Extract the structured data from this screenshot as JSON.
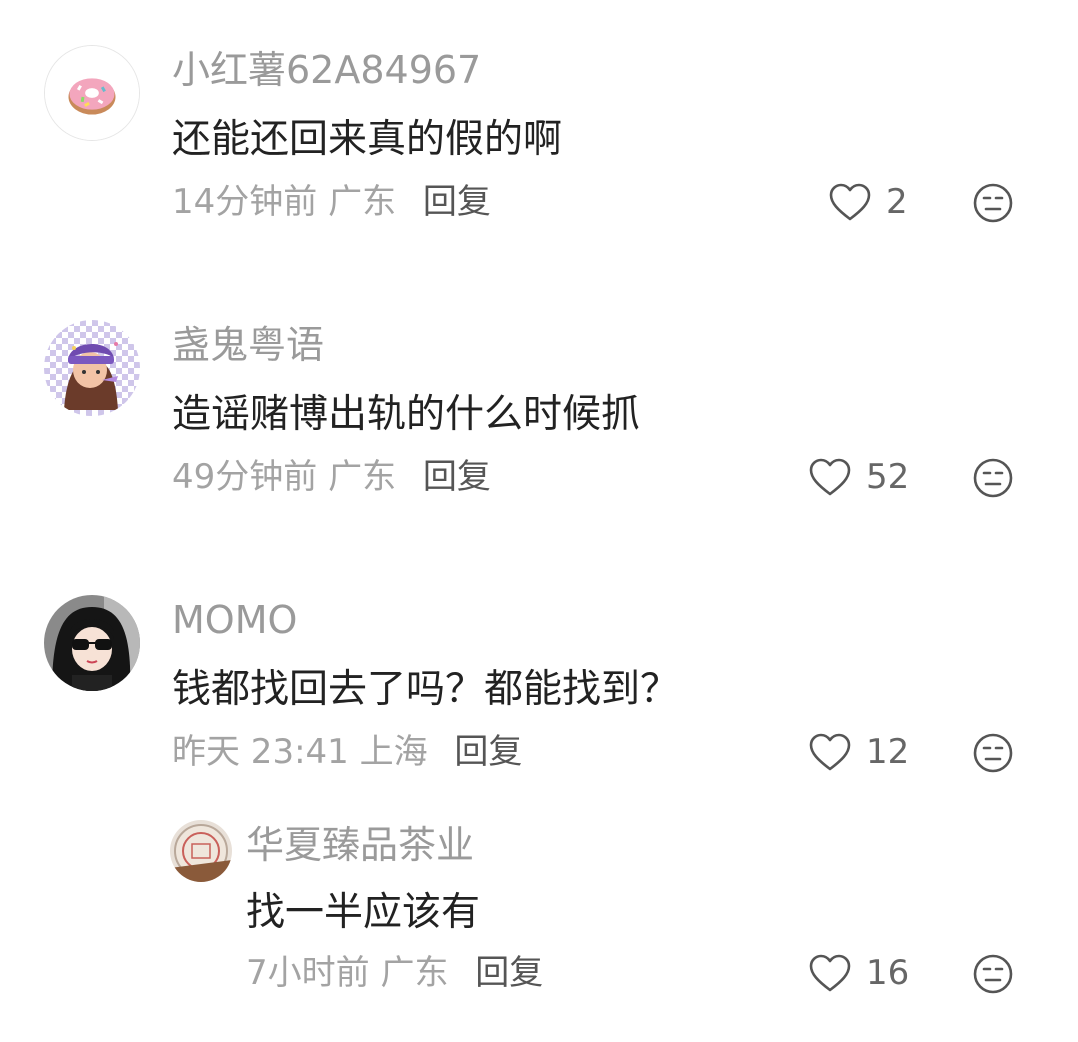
{
  "comments": [
    {
      "username": "小红薯62A84967",
      "text": "还能还回来真的假的啊",
      "time": "14分钟前",
      "location": "广东",
      "reply_label": "回复",
      "likes": "2",
      "avatar_icon": "donut-avatar-icon"
    },
    {
      "username": "盏鬼粤语",
      "text": "造谣赌博出轨的什么时候抓",
      "time": "49分钟前",
      "location": "广东",
      "reply_label": "回复",
      "likes": "52",
      "avatar_icon": "cartoon-girl-avatar-icon"
    },
    {
      "username": "MOMO",
      "text": "钱都找回去了吗？都能找到？",
      "time": "昨天 23:41",
      "location": "上海",
      "reply_label": "回复",
      "likes": "12",
      "avatar_icon": "sunglasses-girl-avatar-icon"
    }
  ],
  "replies": [
    {
      "username": "华夏臻品茶业",
      "text": "找一半应该有",
      "time": "7小时前",
      "location": "广东",
      "reply_label": "回复",
      "likes": "16",
      "avatar_icon": "tea-cake-avatar-icon"
    }
  ],
  "colors": {
    "username": "#9a9a9a",
    "content": "#222222",
    "meta": "#a3a3a3",
    "icon": "#555555"
  }
}
